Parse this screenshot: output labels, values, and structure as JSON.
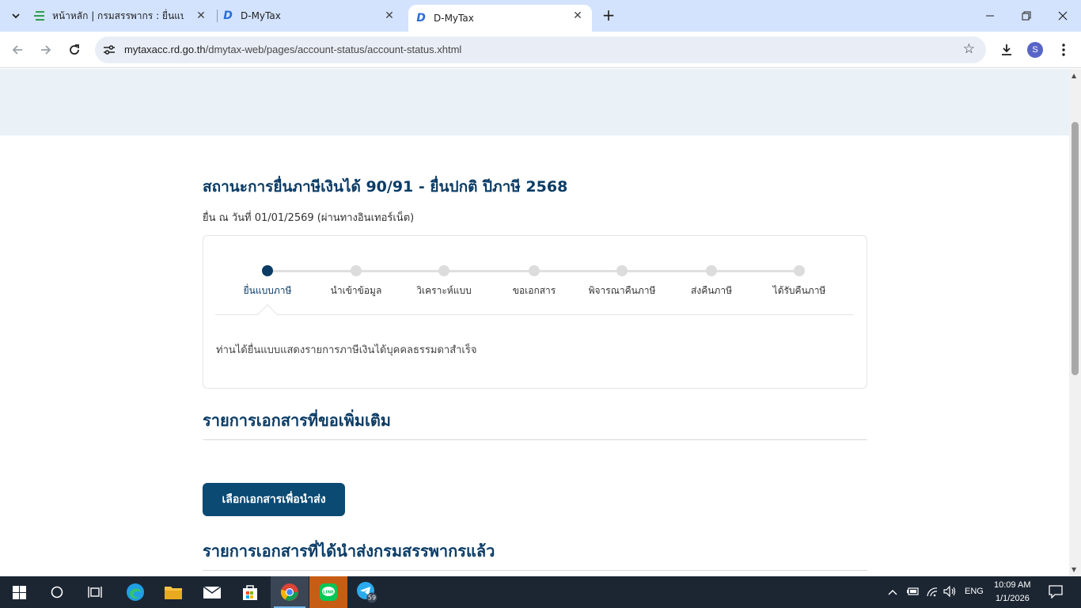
{
  "browser": {
    "tabs": [
      {
        "title": "หน้าหลัก | กรมสรรพากร : ยื่นแบบผ่า",
        "active": false
      },
      {
        "title": "D-MyTax",
        "active": false
      },
      {
        "title": "D-MyTax",
        "active": true
      }
    ],
    "url_host": "mytaxacc.rd.go.th",
    "url_path": "/dmytax-web/pages/account-status/account-status.xhtml",
    "profile_initial": "S",
    "new_tab": "+",
    "close_glyph": "✕"
  },
  "page": {
    "title": "สถานะการยื่นภาษีเงินได้ 90/91 - ยื่นปกติ ปีภาษี 2568",
    "filed_line": "ยื่น ณ วันที่ 01/01/2569 (ผ่านทางอินเทอร์เน็ต)",
    "steps": [
      {
        "label": "ยื่นแบบภาษี",
        "active": true
      },
      {
        "label": "นำเข้าข้อมูล",
        "active": false
      },
      {
        "label": "วิเคราะห์แบบ",
        "active": false
      },
      {
        "label": "ขอเอกสาร",
        "active": false
      },
      {
        "label": "พิจารณาคืนภาษี",
        "active": false
      },
      {
        "label": "ส่งคืนภาษี",
        "active": false
      },
      {
        "label": "ได้รับคืนภาษี",
        "active": false
      }
    ],
    "status_message": "ท่านได้ยื่นแบบแสดงรายการภาษีเงินได้บุคคลธรรมดาสำเร็จ",
    "requested_docs_title": "รายการเอกสารที่ขอเพิ่มเติม",
    "select_docs_button": "เลือกเอกสารเพื่อนำส่ง",
    "submitted_docs_title": "รายการเอกสารที่ได้นำส่งกรมสรรพากรแล้ว"
  },
  "taskbar": {
    "badge_count": "59",
    "language": "ENG",
    "time": "10:09 AM",
    "date": "1/1/2026"
  },
  "colors": {
    "primary": "#0b3c66",
    "button": "#0b4a73",
    "banner": "#eaf2f8",
    "tabbar": "#d3e3fd"
  }
}
